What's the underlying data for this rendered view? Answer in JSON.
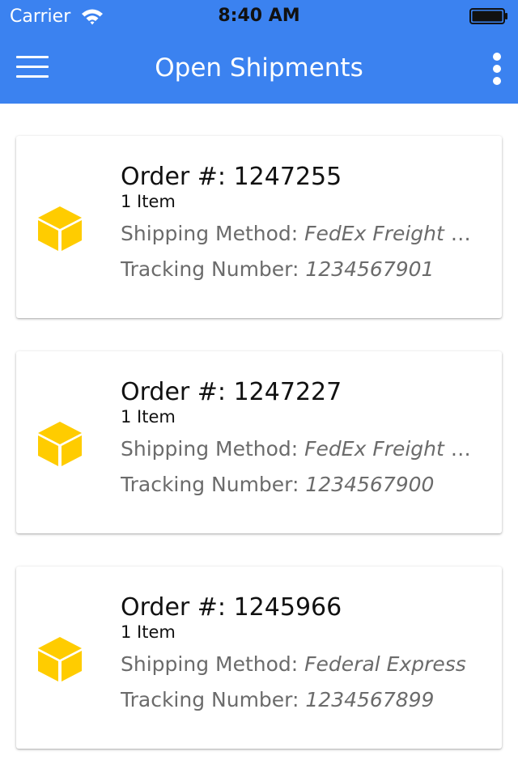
{
  "status_bar": {
    "carrier": "Carrier",
    "time": "8:40 AM",
    "icons": [
      "wifi-icon",
      "battery-icon"
    ]
  },
  "app_bar": {
    "title": "Open Shipments",
    "menu_icon": "hamburger-menu-icon",
    "more_icon": "more-vertical-icon",
    "background_color": "#3b82f0",
    "text_color": "#ffffff"
  },
  "shipment_icon": {
    "name": "package-box-icon",
    "color": "#ffcc00"
  },
  "shipments": [
    {
      "order_label": "Order #:",
      "order_number": "1247255",
      "item_count": "1 Item",
      "shipping_method_label": "Shipping Method:",
      "shipping_method": "FedEx Freight Economy",
      "tracking_label": "Tracking Number:",
      "tracking_number": "1234567901"
    },
    {
      "order_label": "Order #:",
      "order_number": "1247227",
      "item_count": "1 Item",
      "shipping_method_label": "Shipping Method:",
      "shipping_method": "FedEx Freight Economy",
      "tracking_label": "Tracking Number:",
      "tracking_number": "1234567900"
    },
    {
      "order_label": "Order #:",
      "order_number": "1245966",
      "item_count": "1 Item",
      "shipping_method_label": "Shipping Method:",
      "shipping_method": "Federal Express",
      "tracking_label": "Tracking Number:",
      "tracking_number": "1234567899"
    }
  ]
}
